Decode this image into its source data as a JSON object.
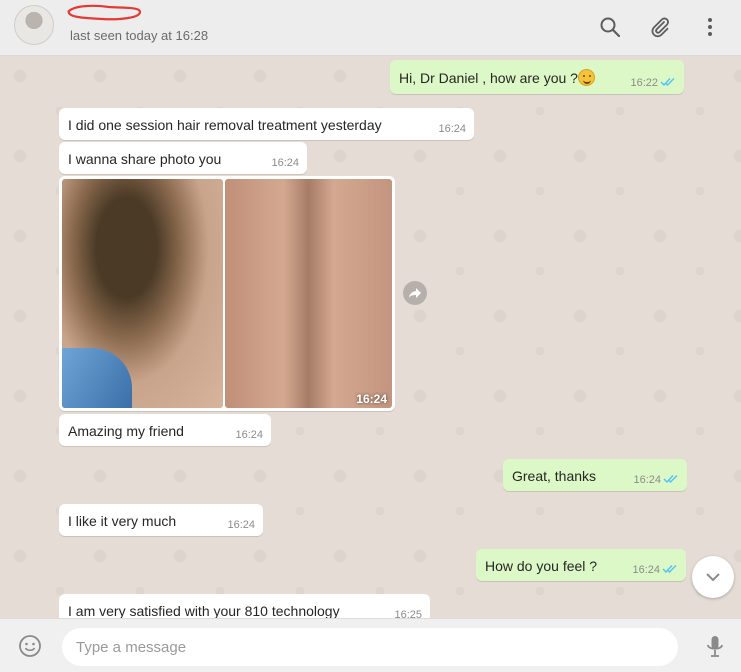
{
  "header": {
    "last_seen": "last seen today at 16:28",
    "icons": [
      "search-icon",
      "attach-icon",
      "menu-icon"
    ]
  },
  "messages": [
    {
      "direction": "out",
      "text": "Hi, Dr Daniel , how are you ?",
      "emoji": "smile",
      "time": "16:22",
      "status": "read"
    },
    {
      "direction": "in",
      "text": "I did one session hair removal treatment yesterday",
      "time": "16:24"
    },
    {
      "direction": "in",
      "text": "I wanna share photo you",
      "time": "16:24"
    },
    {
      "direction": "in",
      "type": "photo",
      "time": "16:24"
    },
    {
      "direction": "in",
      "text": "Amazing my friend",
      "time": "16:24"
    },
    {
      "direction": "out",
      "text": "Great, thanks",
      "time": "16:24",
      "status": "read"
    },
    {
      "direction": "in",
      "text": "I like it very much",
      "time": "16:24"
    },
    {
      "direction": "out",
      "text": "How do you feel ?",
      "time": "16:24",
      "status": "read"
    },
    {
      "direction": "in",
      "text": "I am very satisfied with your 810 technology",
      "time": "16:25"
    }
  ],
  "composer": {
    "placeholder": "Type a message"
  },
  "colors": {
    "outgoing_bubble": "#dcf8c6",
    "incoming_bubble": "#ffffff",
    "read_ticks": "#4fc3f7",
    "chat_background": "#e5ddd5",
    "scribble": "#e53935"
  }
}
